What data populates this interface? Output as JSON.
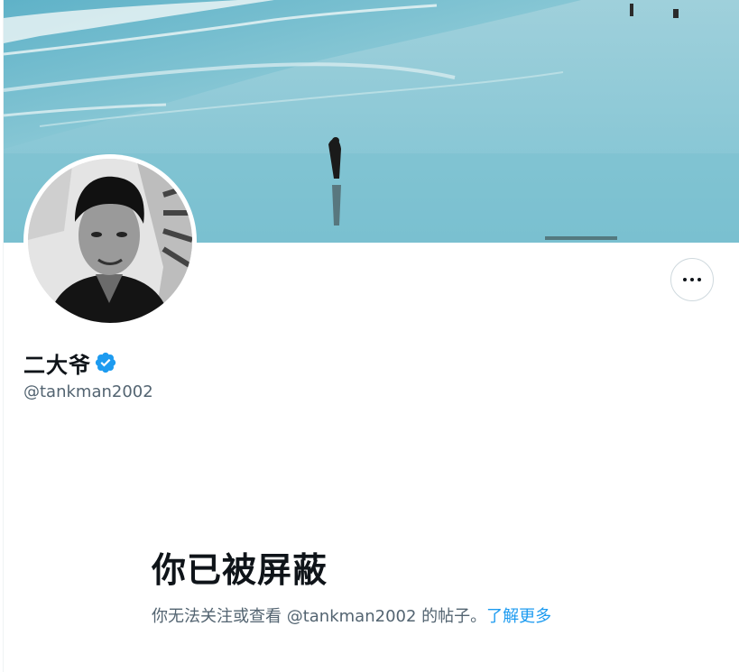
{
  "profile": {
    "display_name": "二大爷",
    "handle": "@tankman2002",
    "verified": true
  },
  "icons": {
    "verified": "verified-badge-icon",
    "more": "more-horizontal-icon"
  },
  "blocked": {
    "title": "你已被屏蔽",
    "description_prefix": "你无法关注或查看 @tankman2002 的帖子。",
    "learn_more": "了解更多"
  },
  "colors": {
    "accent": "#1d9bf0",
    "text_primary": "#0f1419",
    "text_secondary": "#536471",
    "border": "#cfd9de"
  }
}
